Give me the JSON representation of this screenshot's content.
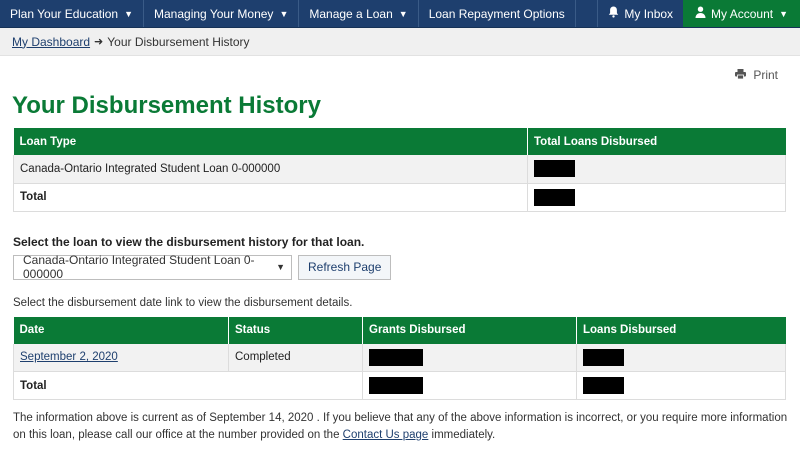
{
  "nav": {
    "items": [
      {
        "label": "Plan Your Education",
        "has_caret": true
      },
      {
        "label": "Managing Your Money",
        "has_caret": true
      },
      {
        "label": "Manage a Loan",
        "has_caret": true
      },
      {
        "label": "Loan Repayment Options",
        "has_caret": false
      }
    ],
    "inbox_label": "My Inbox",
    "account_label": "My Account"
  },
  "breadcrumb": {
    "home": "My Dashboard",
    "current": "Your Disbursement History"
  },
  "print_label": "Print",
  "page_title": "Your Disbursement History",
  "loans_table": {
    "headers": [
      "Loan Type",
      "Total Loans Disbursed"
    ],
    "rows": [
      {
        "loan_type": "Canada-Ontario Integrated Student Loan 0-000000",
        "total": "[redacted]"
      }
    ],
    "total_label": "Total"
  },
  "select_section": {
    "prompt": "Select the loan to view the disbursement history for that loan.",
    "selected_loan": "Canada-Ontario Integrated Student Loan 0-000000",
    "refresh_label": "Refresh Page"
  },
  "history_hint": "Select the disbursement date link to view the disbursement details.",
  "history_table": {
    "headers": [
      "Date",
      "Status",
      "Grants Disbursed",
      "Loans Disbursed"
    ],
    "rows": [
      {
        "date": "September 2, 2020",
        "status": "Completed"
      }
    ],
    "total_label": "Total"
  },
  "footer": {
    "text_before": "The information above is current as of September 14, 2020 . If you believe that any of the above information is incorrect, or you require more information on this loan, please call our office at the number provided on the ",
    "link": "Contact Us page",
    "text_after": " immediately."
  },
  "colors": {
    "nav_bg": "#1e3f6e",
    "accent_green": "#0a7a36"
  }
}
